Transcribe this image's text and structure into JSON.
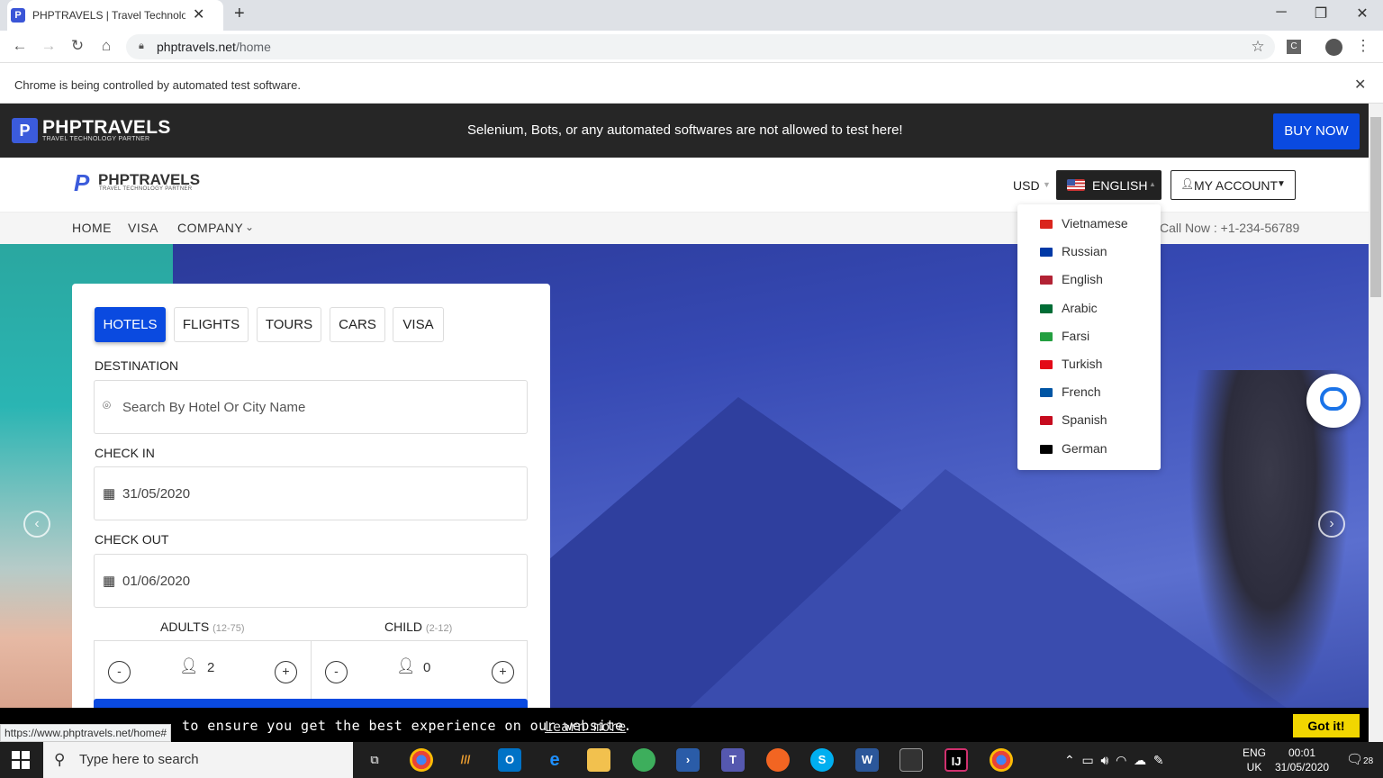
{
  "browser": {
    "tab_title": "PHPTRAVELS | Travel Technology",
    "tab_favicon": "phptravels-favicon",
    "url_host": "phptravels.net",
    "url_path": "/home",
    "infobar_text": "Chrome is being controlled by automated test software.",
    "status_url": "https://www.phptravels.net/home#"
  },
  "topbar": {
    "brand": "PHPTRAVELS",
    "tagline": "TRAVEL TECHNOLOGY PARTNER",
    "message": "Selenium, Bots, or any automated softwares are not allowed to test here!",
    "buy_now": "BUY NOW"
  },
  "header": {
    "brand": "PHPTRAVELS",
    "tagline": "TRAVEL TECHNOLOGY PARTNER",
    "currency": "USD",
    "language": "ENGLISH",
    "account": "MY ACCOUNT"
  },
  "nav": {
    "items": [
      "HOME",
      "VISA",
      "COMPANY"
    ],
    "call": "Call Now : +1-234-56789"
  },
  "language_menu": [
    {
      "label": "Vietnamese",
      "flag": "vn",
      "color": "#da251d"
    },
    {
      "label": "Russian",
      "flag": "ru",
      "color": "#0039a6"
    },
    {
      "label": "English",
      "flag": "us",
      "color": "#b22234"
    },
    {
      "label": "Arabic",
      "flag": "sa",
      "color": "#006c35"
    },
    {
      "label": "Farsi",
      "flag": "ir",
      "color": "#239f40"
    },
    {
      "label": "Turkish",
      "flag": "tr",
      "color": "#e30a17"
    },
    {
      "label": "French",
      "flag": "fr",
      "color": "#0055a4"
    },
    {
      "label": "Spanish",
      "flag": "es",
      "color": "#c60b1e"
    },
    {
      "label": "German",
      "flag": "de",
      "color": "#000000"
    }
  ],
  "search": {
    "tabs": [
      "HOTELS",
      "FLIGHTS",
      "TOURS",
      "CARS",
      "VISA"
    ],
    "active_tab": "HOTELS",
    "destination_label": "DESTINATION",
    "destination_placeholder": "Search By Hotel Or City Name",
    "checkin_label": "CHECK IN",
    "checkin_value": "31/05/2020",
    "checkout_label": "CHECK OUT",
    "checkout_value": "01/06/2020",
    "adults_label": "ADULTS",
    "adults_range": "(12-75)",
    "adults_value": "2",
    "child_label": "CHILD",
    "child_range": "(2-12)",
    "child_value": "0",
    "minus": "-",
    "plus": "+"
  },
  "cookie": {
    "text": "to ensure you get the best experience on our website.",
    "learn_more": "Learn more",
    "got_it": "Got it!"
  },
  "taskbar": {
    "search_placeholder": "Type here to search",
    "lang_line1": "ENG",
    "lang_line2": "UK",
    "time": "00:01",
    "date": "31/05/2020",
    "notifications": "28"
  },
  "colors": {
    "brand_blue": "#0a4ae0",
    "topbar_dark": "#262626",
    "cookie_button": "#f1d600"
  }
}
